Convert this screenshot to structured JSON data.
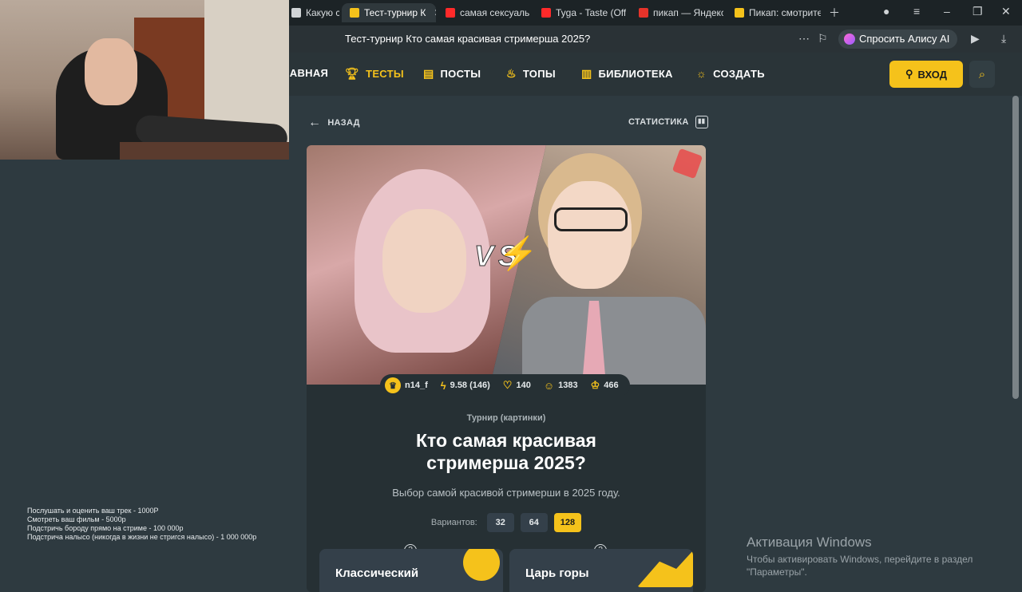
{
  "browser": {
    "tabs": [
      {
        "title": "Какую ст",
        "active": false,
        "fav": "#d0d4d6"
      },
      {
        "title": "Тест-турнир К",
        "active": true,
        "fav": "#f5c21b"
      },
      {
        "title": "самая сексуаль",
        "active": false,
        "fav": "#ff2a2a"
      },
      {
        "title": "Tyga - Taste (Off",
        "active": false,
        "fav": "#ff2a2a"
      },
      {
        "title": "пикап — Яндекс",
        "active": false,
        "fav": "#e6332a"
      },
      {
        "title": "Пикап: смотрите",
        "active": false,
        "fav": "#f5c21b"
      }
    ],
    "address_title": "Тест-турнир Кто самая красивая стримерша 2025?",
    "alice_label": "Спросить Алису AI"
  },
  "nav": {
    "items": [
      {
        "label": "ГЛАВНАЯ",
        "icon": "home-icon",
        "active": false
      },
      {
        "label": "ТЕСТЫ",
        "icon": "trophy-icon",
        "active": true
      },
      {
        "label": "ПОСТЫ",
        "icon": "note-icon",
        "active": false
      },
      {
        "label": "ТОПЫ",
        "icon": "flame-icon",
        "active": false
      },
      {
        "label": "БИБЛИОТЕКА",
        "icon": "book-icon",
        "active": false
      },
      {
        "label": "СОЗДАТЬ",
        "icon": "bulb-icon",
        "active": false
      }
    ],
    "login_label": "ВХОД"
  },
  "page": {
    "back_label": "НАЗАД",
    "stats_label": "СТАТИСТИКА",
    "hero_badge": "VS",
    "meta": {
      "author": "n14_f",
      "rating": "9.58 (146)",
      "likes": "140",
      "players": "1383",
      "crowns": "466"
    },
    "category": "Турнир (картинки)",
    "title": "Кто самая красивая стримерша 2025?",
    "description": "Выбор самой красивой стримерши в 2025 году.",
    "variants_label": "Вариантов:",
    "variants": [
      "32",
      "64",
      "128"
    ],
    "variants_selected": "128",
    "modes": [
      "Классический",
      "Царь горы"
    ]
  },
  "overlay": {
    "lines": [
      "Послушать и оценить ваш трек - 1000Р",
      "Смотреть ваш фильм - 5000р",
      "Подстричь бороду прямо на стриме - 100 000р",
      "Подстрича налысо (никогда в жизни не стригся налысо) - 1 000 000р"
    ]
  },
  "windows_activation": {
    "title": "Активация Windows",
    "line1": "Чтобы активировать Windows, перейдите в раздел",
    "line2": "\"Параметры\"."
  },
  "colors": {
    "accent": "#f5c21b",
    "bg": "#2e3a40",
    "card": "#263034"
  }
}
